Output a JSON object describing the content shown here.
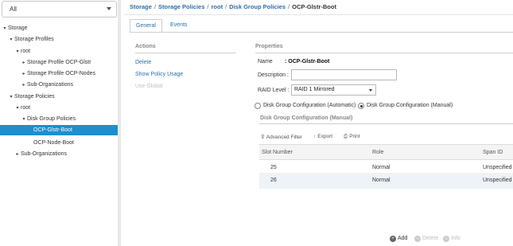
{
  "filter": {
    "value": "All"
  },
  "tree": {
    "storage": "Storage",
    "storage_profiles": "Storage Profiles",
    "root1": "root",
    "profile_glstr": "Storage Profile OCP-Glstr",
    "profile_nodes": "Storage Profile OCP-Nodes",
    "suborg1": "Sub-Organizations",
    "storage_policies": "Storage Policies",
    "root2": "root",
    "disk_group_policies": "Disk Group Policies",
    "ocp_glstr_boot": "OCP-Glstr-Boot",
    "ocp_node_boot": "OCP-Node-Boot",
    "suborg2": "Sub-Organizations"
  },
  "breadcrumb": [
    "Storage",
    "Storage Policies",
    "root",
    "Disk Group Policies",
    "OCP-Glstr-Boot"
  ],
  "tabs": [
    "General",
    "Events"
  ],
  "actions": {
    "title": "Actions",
    "delete": "Delete",
    "show_policy_usage": "Show Policy Usage",
    "use_global": "Use Global"
  },
  "properties": {
    "title": "Properties",
    "name_label": "Name",
    "name_value": ": OCP-Glstr-Boot",
    "description_label": "Description :",
    "description_value": "",
    "raid_label": "RAID Level :",
    "raid_value": "RAID 1 Mirrored",
    "radio_auto": "Disk Group Configuration (Automatic)",
    "radio_manual": "Disk Group Configuration (Manual)"
  },
  "disk_group": {
    "title": "Disk Group Configuration (Manual)",
    "toolbar": {
      "filter": "Advanced Filter",
      "export": "Export",
      "print": "Print"
    },
    "columns": [
      "Slot Number",
      "Role",
      "Span ID"
    ],
    "rows": [
      [
        "25",
        "Normal",
        "Unspecified"
      ],
      [
        "26",
        "Normal",
        "Unspecified"
      ]
    ]
  },
  "bottom": {
    "add": "Add",
    "delete": "Delete",
    "info": "Info"
  }
}
